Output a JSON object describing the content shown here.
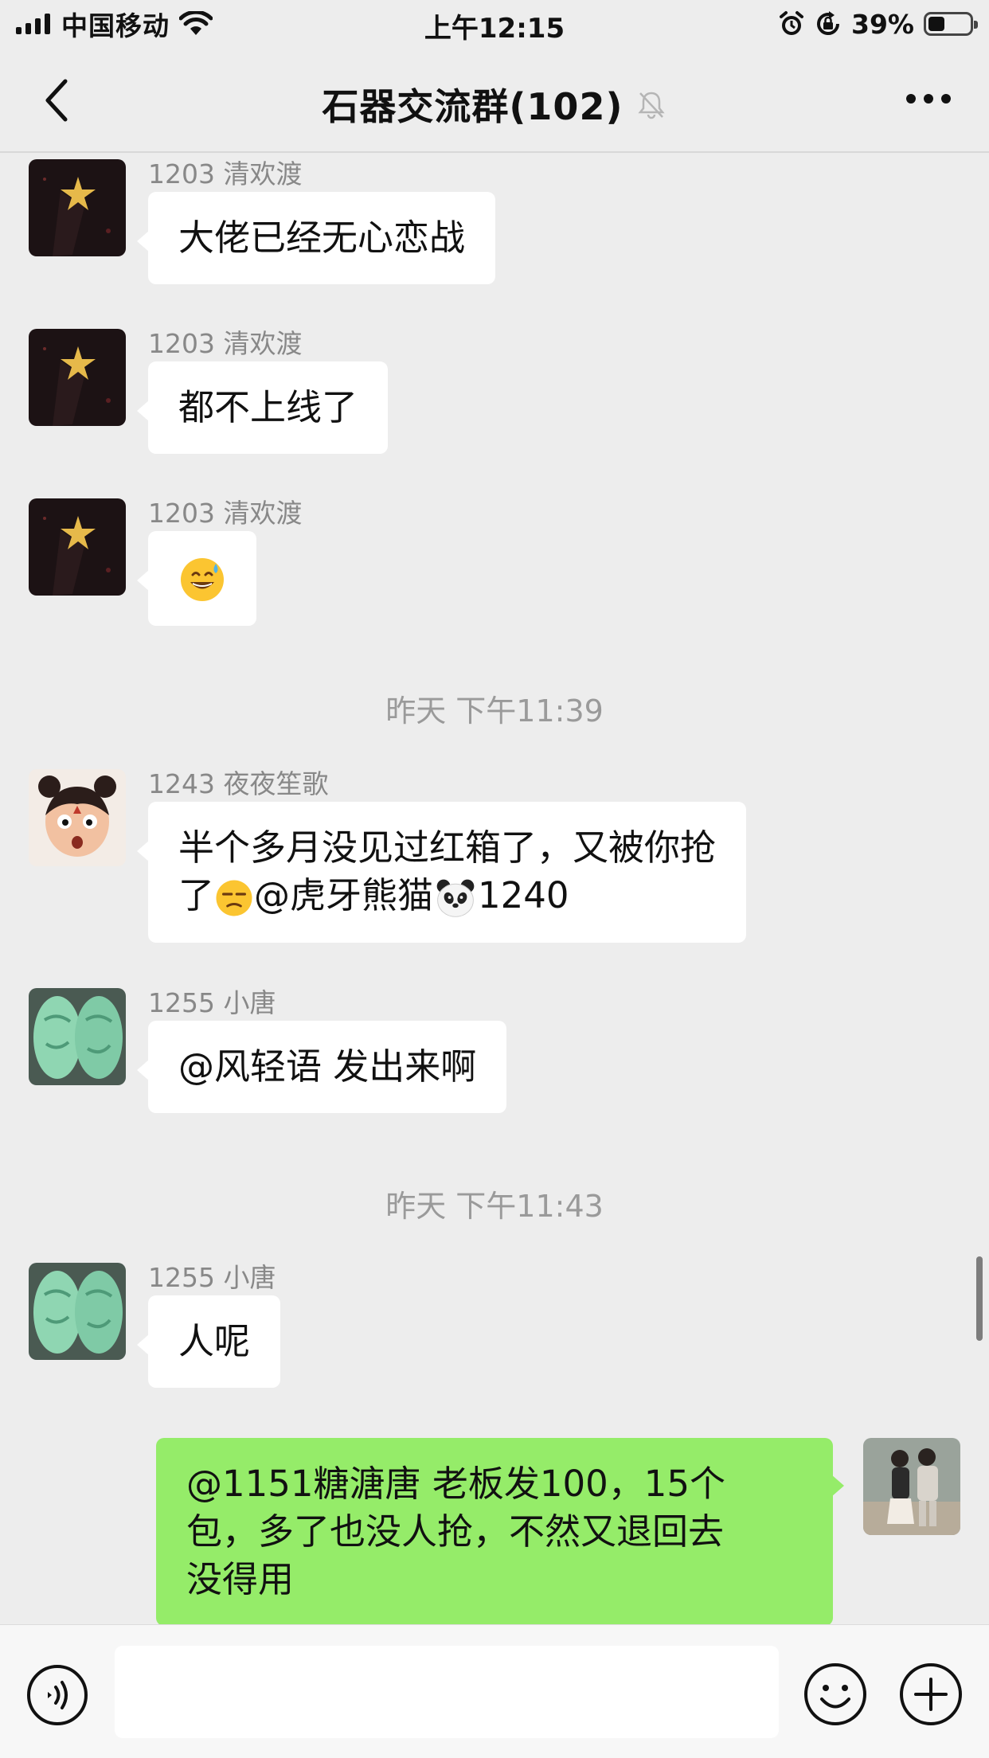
{
  "status_bar": {
    "carrier": "中国移动",
    "time": "上午12:15",
    "battery_percent": "39%",
    "battery_level": 0.39,
    "icons": [
      "signal-icon",
      "wifi-icon",
      "alarm-icon",
      "rotation-lock-icon",
      "battery-icon"
    ]
  },
  "nav": {
    "title": "石器交流群(102)",
    "back_icon": "chevron-left-icon",
    "mute_icon": "bell-mute-icon",
    "more_icon": "more-icon"
  },
  "messages": [
    {
      "sender": "1203 清欢渡",
      "text": "大佬已经无心恋战"
    },
    {
      "sender": "1203 清欢渡",
      "text": "都不上线了"
    },
    {
      "sender": "1203 清欢渡",
      "emoji": "sweat-smile-emoji"
    },
    {
      "timestamp": "昨天 下午11:39"
    },
    {
      "sender": "1243 夜夜笙歌",
      "text_line1": "半个多月没见过红箱了，又被你抢",
      "text_line2_a": "了",
      "text_line2_b": "@虎牙熊猫",
      "text_line2_c": "1240"
    },
    {
      "sender": "1255 小唐",
      "text": "@风轻语 发出来啊"
    },
    {
      "timestamp": "昨天 下午11:43"
    },
    {
      "sender": "1255 小唐",
      "text": "人呢"
    },
    {
      "self": true,
      "text_line1": "@1151糖溏唐 老板发100，15个",
      "text_line2": "包，多了也没人抢，不然又退回去",
      "text_line3": "没得用"
    }
  ],
  "input_bar": {
    "voice_icon": "voice-icon",
    "emoji_icon": "emoji-icon",
    "plus_icon": "plus-icon",
    "text": ""
  },
  "colors": {
    "background": "#ededed",
    "bubble_other": "#ffffff",
    "bubble_self": "#95ec69",
    "meta_text": "#888888"
  }
}
